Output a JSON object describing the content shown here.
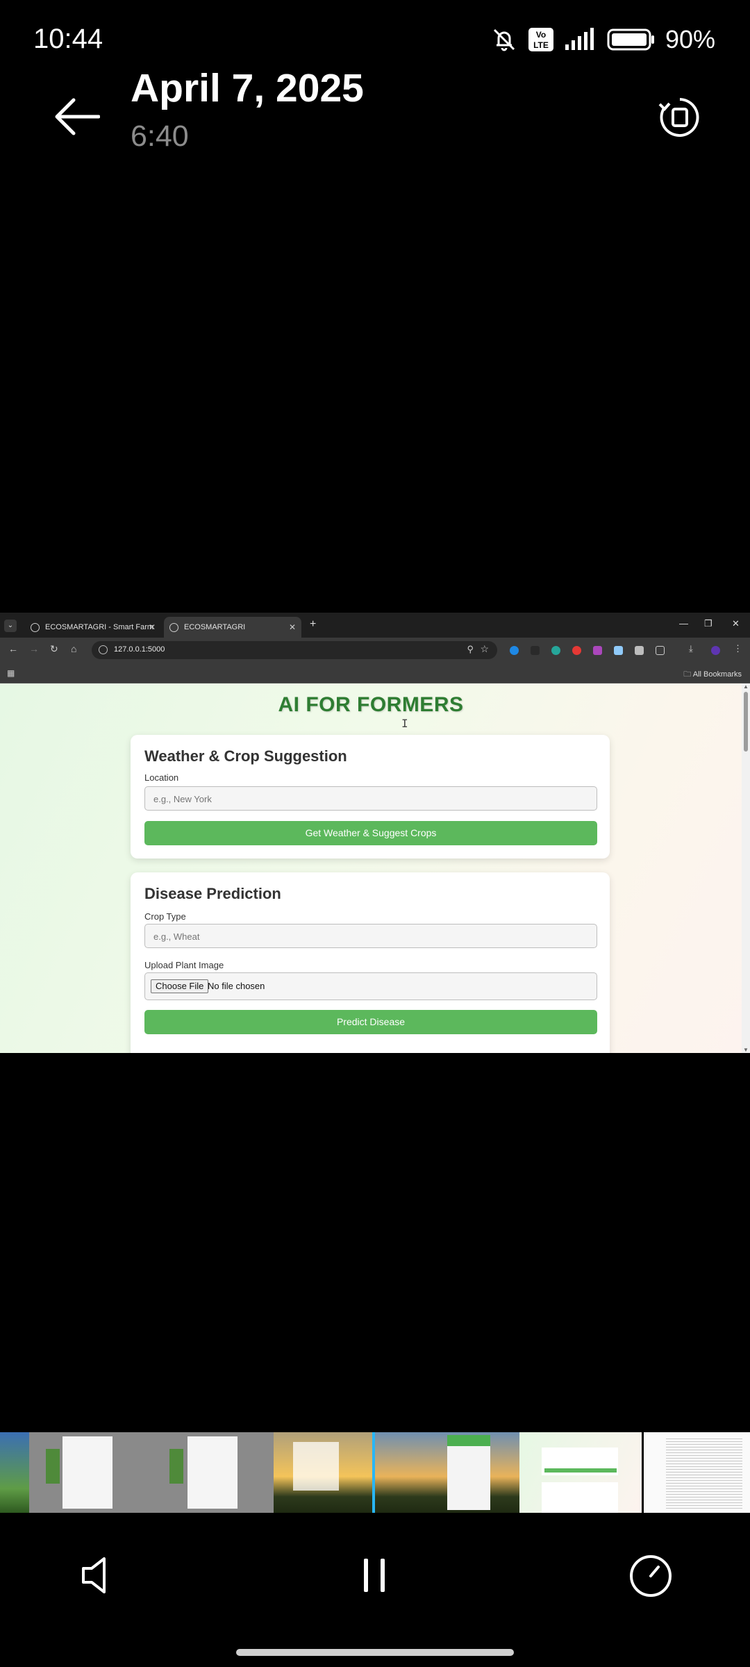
{
  "status_bar": {
    "time": "10:44",
    "icons": [
      "bell-off-icon",
      "volte-icon",
      "signal-icon",
      "battery-icon"
    ],
    "battery": "90%"
  },
  "header": {
    "date": "April 7, 2025",
    "duration": "6:40",
    "back_icon": "arrow-left-icon",
    "rotate_icon": "rotate-screen-icon"
  },
  "browser": {
    "tabs": [
      {
        "title": "ECOSMARTAGRI - Smart Farm",
        "active": false
      },
      {
        "title": "ECOSMARTAGRI",
        "active": true
      }
    ],
    "url": "127.0.0.1:5000",
    "bookmarks_label": "All Bookmarks"
  },
  "page": {
    "title": "AI FOR FORMERS",
    "weather_card": {
      "heading": "Weather & Crop Suggestion",
      "location_label": "Location",
      "location_placeholder": "e.g., New York",
      "button": "Get Weather & Suggest Crops"
    },
    "disease_card": {
      "heading": "Disease Prediction",
      "crop_label": "Crop Type",
      "crop_placeholder": "e.g., Wheat",
      "upload_label": "Upload Plant Image",
      "choose_file": "Choose File",
      "no_file": "No file chosen",
      "button": "Predict Disease"
    }
  },
  "controls": {
    "volume_icon": "speaker-icon",
    "pause_icon": "pause-icon",
    "speed_icon": "speedometer-icon"
  },
  "colors": {
    "accent_green": "#5cb85c",
    "title_green": "#2e7d32",
    "filmstrip_marker": "#29b6f6"
  }
}
